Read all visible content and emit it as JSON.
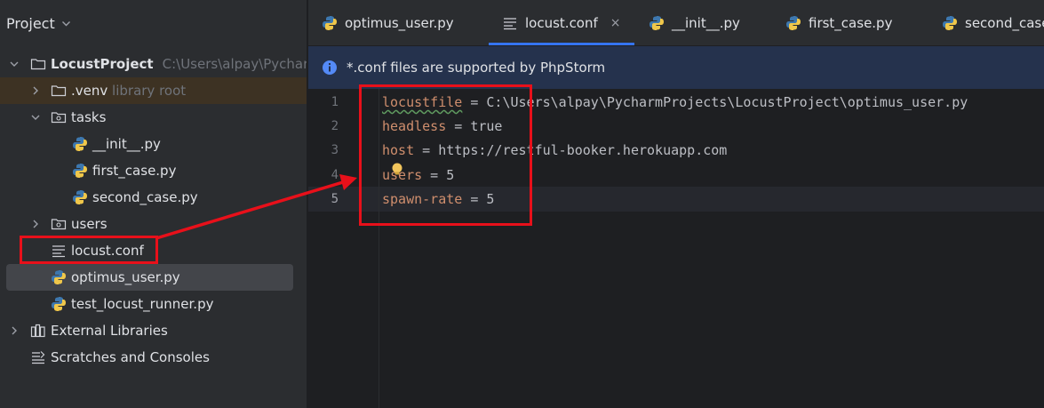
{
  "project_panel": {
    "title": "Project",
    "tree": [
      {
        "label": "LocustProject",
        "path": "C:\\Users\\alpay\\PycharmProjects\\LocustProject",
        "icon": "folder-icon",
        "expanded": true
      },
      {
        "label": ".venv",
        "note": "library root",
        "icon": "folder-icon",
        "expanded": false
      },
      {
        "label": "tasks",
        "icon": "package-folder-icon",
        "expanded": true
      },
      {
        "label": "__init__.py",
        "icon": "python-file-icon"
      },
      {
        "label": "first_case.py",
        "icon": "python-file-icon"
      },
      {
        "label": "second_case.py",
        "icon": "python-file-icon"
      },
      {
        "label": "users",
        "icon": "package-folder-icon",
        "expanded": false
      },
      {
        "label": "locust.conf",
        "icon": "text-file-icon"
      },
      {
        "label": "optimus_user.py",
        "icon": "python-file-icon",
        "selected": true
      },
      {
        "label": "test_locust_runner.py",
        "icon": "python-file-icon"
      },
      {
        "label": "External Libraries",
        "icon": "library-icon",
        "expanded": false
      },
      {
        "label": "Scratches and Consoles",
        "icon": "scratches-icon"
      }
    ]
  },
  "tabs": [
    {
      "label": "optimus_user.py",
      "icon": "python-file-icon"
    },
    {
      "label": "locust.conf",
      "icon": "text-file-icon",
      "active": true,
      "close": "×"
    },
    {
      "label": "__init__.py",
      "icon": "python-file-icon"
    },
    {
      "label": "first_case.py",
      "icon": "python-file-icon"
    },
    {
      "label": "second_case.py",
      "icon": "python-file-icon"
    }
  ],
  "banner": {
    "text": "*.conf files are supported by PhpStorm",
    "icon": "info-icon"
  },
  "editor": {
    "current_line": 5,
    "lines": [
      {
        "number": "1",
        "key": "locustfile",
        "eq": " = ",
        "value": "C:\\Users\\alpay\\PycharmProjects\\LocustProject\\optimus_user.py"
      },
      {
        "number": "2",
        "key": "headless",
        "eq": " = ",
        "value": "true"
      },
      {
        "number": "3",
        "key": "host",
        "eq": " = ",
        "value": "https://restful-booker.herokuapp.com"
      },
      {
        "number": "4",
        "key": "users",
        "eq": " = ",
        "value": "5"
      },
      {
        "number": "5",
        "key": "spawn-rate",
        "eq": " = ",
        "value": "5"
      }
    ]
  },
  "colors": {
    "accent": "#3574f0",
    "annotation": "#e8101a",
    "keyword": "#cf8e6d",
    "python_blue": "#3d77ae",
    "python_yellow": "#f0c74a"
  }
}
